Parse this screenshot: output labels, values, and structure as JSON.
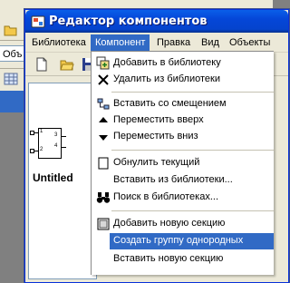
{
  "window": {
    "title": "Редактор компонентов"
  },
  "background": {
    "tab_label": "Объ"
  },
  "menubar": {
    "items": [
      {
        "label": "Библиотека",
        "active": false
      },
      {
        "label": "Компонент",
        "active": true
      },
      {
        "label": "Правка",
        "active": false
      },
      {
        "label": "Вид",
        "active": false
      },
      {
        "label": "Объекты",
        "active": false
      }
    ]
  },
  "toolbar": {
    "buttons": [
      "new-document-icon",
      "open-folder-icon",
      "save-icon"
    ]
  },
  "canvas": {
    "component_caption": "Untitled",
    "pin_labels": [
      "1",
      "2",
      "3",
      "4"
    ]
  },
  "menu": {
    "items": [
      {
        "label": "Добавить в библиотеку",
        "icon": "add-to-library-icon"
      },
      {
        "label": "Удалить из библиотеки",
        "icon": "delete-x-icon"
      },
      {
        "label": "Вставить со смещением",
        "icon": "insert-offset-icon"
      },
      {
        "label": "Переместить вверх",
        "icon": "arrow-up-icon"
      },
      {
        "label": "Переместить вниз",
        "icon": "arrow-down-icon"
      },
      {
        "label": "Обнулить текущий",
        "icon": "empty-checkbox-icon"
      },
      {
        "label": "Вставить из библиотеки...",
        "icon": ""
      },
      {
        "label": "Поиск в библиотеках...",
        "icon": "binoculars-icon"
      },
      {
        "label": "Добавить новую секцию",
        "icon": "add-section-icon"
      },
      {
        "label": "Создать группу однородных",
        "icon": "",
        "highlighted": true
      },
      {
        "label": "Вставить новую секцию",
        "icon": ""
      }
    ]
  },
  "colors": {
    "highlight": "#316ac5",
    "title_bar": "#0546d8",
    "face": "#ece9d8"
  }
}
